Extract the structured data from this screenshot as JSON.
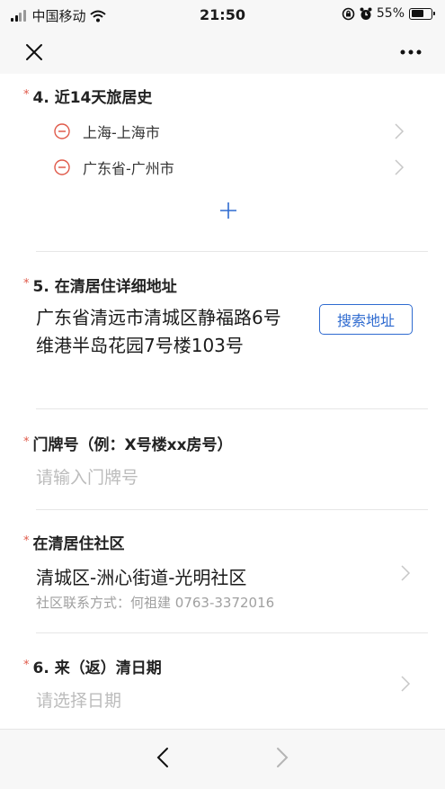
{
  "status_bar": {
    "carrier": "中国移动",
    "time": "21:50",
    "battery": "55%"
  },
  "nav": {
    "close_icon": "close-icon",
    "more_icon": "more-icon"
  },
  "travel_history": {
    "required_mark": "*",
    "label": "4. 近14天旅居史",
    "items": [
      {
        "text": "上海-上海市"
      },
      {
        "text": "广东省-广州市"
      }
    ],
    "add_icon": "plus-icon"
  },
  "address": {
    "required_mark": "*",
    "label": "5. 在清居住详细地址",
    "value": "广东省清远市清城区静福路6号维港半岛花园7号楼103号",
    "search_button": "搜索地址"
  },
  "house_number": {
    "required_mark": "*",
    "label": "门牌号（例：X号楼xx房号）",
    "placeholder": "请输入门牌号"
  },
  "community": {
    "required_mark": "*",
    "label": "在清居住社区",
    "value": "清城区-洲心街道-光明社区",
    "contact": "社区联系方式：何祖建 0763-3372016"
  },
  "arrival_date": {
    "required_mark": "*",
    "label": "6. 来（返）清日期",
    "placeholder": "请选择日期"
  },
  "toolbar": {
    "back_icon": "back-icon",
    "forward_icon": "forward-icon"
  },
  "colors": {
    "accent": "#2f6bd0",
    "required": "#e05a4a",
    "minus": "#e05a4a",
    "bar_bg": "#f7f7f7"
  }
}
